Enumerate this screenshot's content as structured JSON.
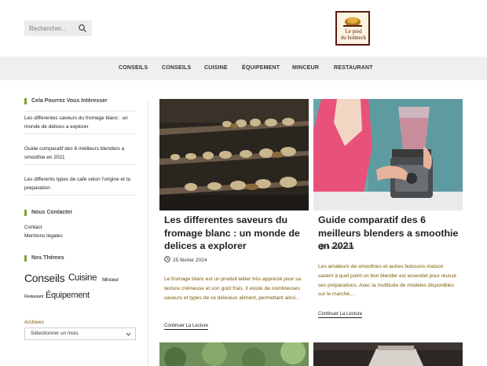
{
  "search": {
    "placeholder": "Rechercher..."
  },
  "logo": {
    "line1": "Le pied",
    "line2": "du hohneck"
  },
  "nav": {
    "items": [
      "Conseils",
      "Conseils",
      "Cuisine",
      "Équipement",
      "Minceur",
      "Restaurant"
    ]
  },
  "sidebar": {
    "interest_title": "Cela Pourrez Vous Intéresser",
    "interest_links": [
      "Les differentes saveurs du fromage blanc : un monde de delices a explorer",
      "Guide comparatif des 6 meilleurs blenders a smoothie en 2021",
      "Les differents types de cafe selon l'origine et la preparation"
    ],
    "contact_title": "Nous Contacter",
    "contact_links": [
      "Contact",
      "Mentions légales"
    ],
    "themes_title": "Nos Thèmes",
    "themes": [
      "Conseils",
      "Cuisine",
      "Minceur",
      "Restaurant",
      "Équipement"
    ],
    "archives_label": "Archives",
    "archives_select": "Sélectionner un mois"
  },
  "cards": [
    {
      "title": "Les differentes saveurs du fromage blanc : un monde de delices a explorer",
      "date": "25 février 2024",
      "excerpt": "Le fromage blanc est un produit laitier très apprécié pour sa texture crémeuse et son goût frais. Il existe de nombreuses saveurs et types de ce délicieux aliment, permettant ainsi…",
      "more": "Continuer La Lecture"
    },
    {
      "title": "Guide comparatif des 6 meilleurs blenders a smoothie en 2021",
      "date": "9 août 2023",
      "excerpt": "Les amateurs de smoothies et autres boissons maison savent à quel point un bon blender est essentiel pour réussir ses préparations. Avec la multitude de modèles disponibles sur le marché,…",
      "more": "Continuer La Lecture"
    }
  ],
  "colors": {
    "accent": "#7aa632",
    "excerpt": "#7a5a00",
    "nav_bg": "#efefef"
  }
}
